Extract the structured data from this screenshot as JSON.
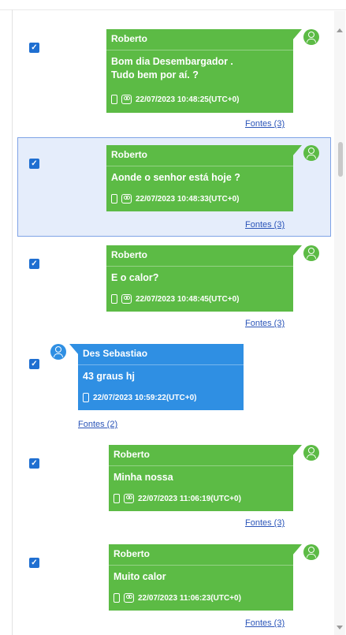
{
  "colors": {
    "outgoing_bubble": "#5cbb45",
    "incoming_bubble": "#2f8fe3",
    "selected_row": "#e5edfb",
    "link": "#2a54b8"
  },
  "messages": [
    {
      "sender": "Roberto",
      "text_lines": [
        "Bom dia Desembargador .",
        "Tudo bem por aí. ?"
      ],
      "timestamp": "22/07/2023 10:48:25(UTC+0)",
      "sources": "Fontes (3)",
      "checked": true,
      "direction": "outgoing"
    },
    {
      "sender": "Roberto",
      "text_lines": [
        "Aonde o senhor está hoje ?"
      ],
      "timestamp": "22/07/2023 10:48:33(UTC+0)",
      "sources": "Fontes (3)",
      "checked": true,
      "direction": "outgoing",
      "selected": true
    },
    {
      "sender": "Roberto",
      "text_lines": [
        "E o calor?"
      ],
      "timestamp": "22/07/2023 10:48:45(UTC+0)",
      "sources": "Fontes (3)",
      "checked": true,
      "direction": "outgoing"
    },
    {
      "sender": "Des Sebastiao",
      "text_lines": [
        "43 graus hj"
      ],
      "timestamp": "22/07/2023 10:59:22(UTC+0)",
      "sources": "Fontes (2)",
      "checked": true,
      "direction": "incoming"
    },
    {
      "sender": "Roberto",
      "text_lines": [
        "Minha nossa"
      ],
      "timestamp": "22/07/2023 11:06:19(UTC+0)",
      "sources": "Fontes (3)",
      "checked": true,
      "direction": "outgoing"
    },
    {
      "sender": "Roberto",
      "text_lines": [
        "Muito calor"
      ],
      "timestamp": "22/07/2023 11:06:23(UTC+0)",
      "sources": "Fontes (3)",
      "checked": true,
      "direction": "outgoing"
    }
  ]
}
